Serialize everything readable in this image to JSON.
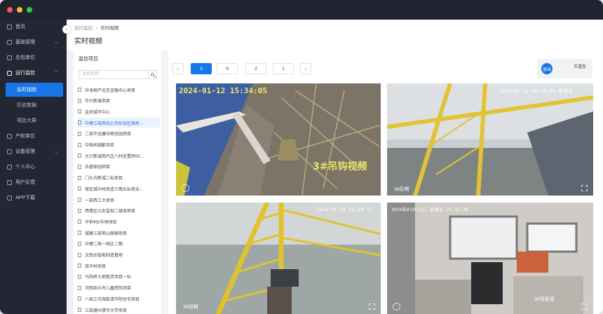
{
  "sidebar": {
    "items": [
      {
        "label": "首页",
        "top": 0
      },
      {
        "label": "基础管理"
      },
      {
        "label": "总包单位"
      },
      {
        "label": "运行监控"
      },
      {
        "label": "产权单位"
      },
      {
        "label": "设备管理"
      },
      {
        "label": "个人中心"
      },
      {
        "label": "用户反馈"
      },
      {
        "label": "APP下载"
      }
    ],
    "sub": [
      "实时视频",
      "历史数据",
      "项目大屏"
    ]
  },
  "breadcrumb": {
    "parent": "运行监控",
    "sep": "/",
    "current": "实时视频"
  },
  "page_title": "实时视频",
  "left_panel": {
    "title": "监控项目",
    "search_placeholder": "项目名称",
    "projects": [
      "中海地产北京金融中心项目",
      "华兴新城项目",
      "金凤城市中心",
      "中建三局西北公司长安区高桥...",
      "二局华北康坊物流园项目",
      "中核闻湖郡项目",
      "大兴新城西片区八村安置房00...",
      "乐盛家园项目",
      "门头沟新城二标项目",
      "保定城中村改造三期五标商业...",
      "一部西工大项目",
      "西青区公安监狱二级改项目",
      "华侨村5号地项目",
      "城建三部商山鼎德项目",
      "中建二局一国企二期",
      "汉南达智能制造基地",
      "南华村项目",
      "马驹桥土地租赁项目一标",
      "河南商丘市儿童医院项目",
      "八局三河海航清华院住宅项目",
      "三部通州清华大学项目"
    ]
  },
  "pager": {
    "pages": [
      "3",
      "9",
      "2",
      "1"
    ],
    "prev": "‹",
    "next": "›"
  },
  "user": {
    "avatar": "退出",
    "name": "王道东"
  },
  "cameras": [
    {
      "timestamp": "2024-01-12  15:34:05",
      "overlay": "3#吊钩视频",
      "label": ""
    },
    {
      "timestamp": "2024-01-12 16:34:05 星期五",
      "overlay": "",
      "label": "3#后臂"
    },
    {
      "timestamp": "2024-01-03 15:24:31",
      "overlay": "",
      "label": "3#前臂"
    },
    {
      "timestamp": "2024年01月12日 星期五 15:32:28",
      "overlay": "",
      "label": "3#驾驶室"
    }
  ],
  "colors": {
    "accent": "#1976e8",
    "sidebar": "#222733"
  }
}
